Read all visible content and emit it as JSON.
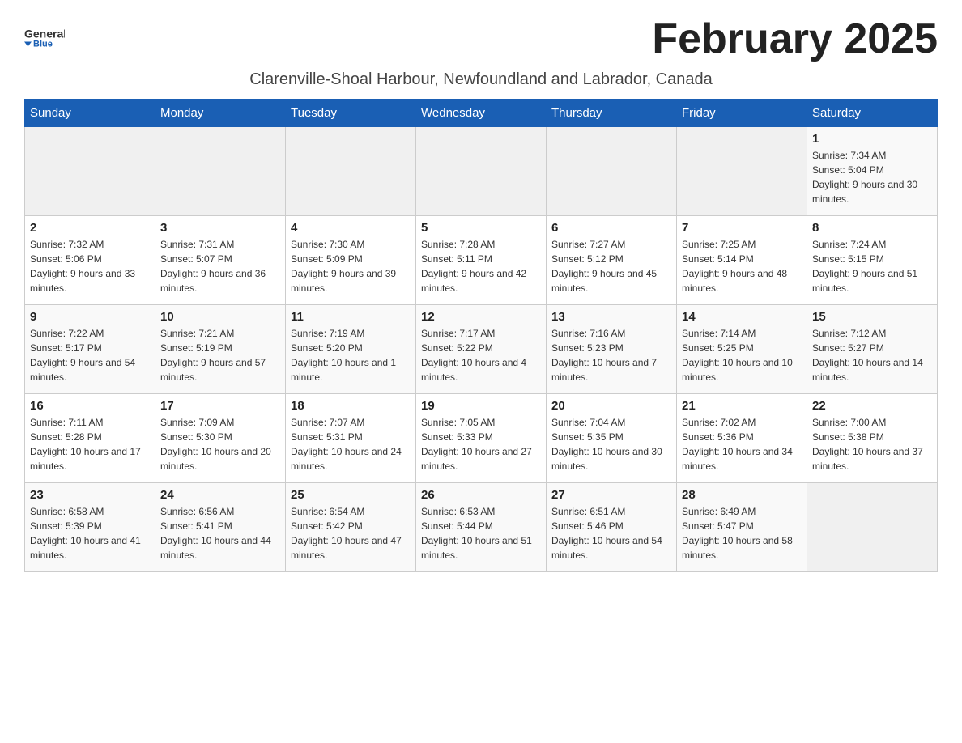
{
  "header": {
    "logo_general": "General",
    "logo_blue": "Blue",
    "month_title": "February 2025",
    "subtitle": "Clarenville-Shoal Harbour, Newfoundland and Labrador, Canada"
  },
  "days_of_week": [
    "Sunday",
    "Monday",
    "Tuesday",
    "Wednesday",
    "Thursday",
    "Friday",
    "Saturday"
  ],
  "weeks": [
    {
      "days": [
        {
          "num": "",
          "info": ""
        },
        {
          "num": "",
          "info": ""
        },
        {
          "num": "",
          "info": ""
        },
        {
          "num": "",
          "info": ""
        },
        {
          "num": "",
          "info": ""
        },
        {
          "num": "",
          "info": ""
        },
        {
          "num": "1",
          "info": "Sunrise: 7:34 AM\nSunset: 5:04 PM\nDaylight: 9 hours and 30 minutes."
        }
      ]
    },
    {
      "days": [
        {
          "num": "2",
          "info": "Sunrise: 7:32 AM\nSunset: 5:06 PM\nDaylight: 9 hours and 33 minutes."
        },
        {
          "num": "3",
          "info": "Sunrise: 7:31 AM\nSunset: 5:07 PM\nDaylight: 9 hours and 36 minutes."
        },
        {
          "num": "4",
          "info": "Sunrise: 7:30 AM\nSunset: 5:09 PM\nDaylight: 9 hours and 39 minutes."
        },
        {
          "num": "5",
          "info": "Sunrise: 7:28 AM\nSunset: 5:11 PM\nDaylight: 9 hours and 42 minutes."
        },
        {
          "num": "6",
          "info": "Sunrise: 7:27 AM\nSunset: 5:12 PM\nDaylight: 9 hours and 45 minutes."
        },
        {
          "num": "7",
          "info": "Sunrise: 7:25 AM\nSunset: 5:14 PM\nDaylight: 9 hours and 48 minutes."
        },
        {
          "num": "8",
          "info": "Sunrise: 7:24 AM\nSunset: 5:15 PM\nDaylight: 9 hours and 51 minutes."
        }
      ]
    },
    {
      "days": [
        {
          "num": "9",
          "info": "Sunrise: 7:22 AM\nSunset: 5:17 PM\nDaylight: 9 hours and 54 minutes."
        },
        {
          "num": "10",
          "info": "Sunrise: 7:21 AM\nSunset: 5:19 PM\nDaylight: 9 hours and 57 minutes."
        },
        {
          "num": "11",
          "info": "Sunrise: 7:19 AM\nSunset: 5:20 PM\nDaylight: 10 hours and 1 minute."
        },
        {
          "num": "12",
          "info": "Sunrise: 7:17 AM\nSunset: 5:22 PM\nDaylight: 10 hours and 4 minutes."
        },
        {
          "num": "13",
          "info": "Sunrise: 7:16 AM\nSunset: 5:23 PM\nDaylight: 10 hours and 7 minutes."
        },
        {
          "num": "14",
          "info": "Sunrise: 7:14 AM\nSunset: 5:25 PM\nDaylight: 10 hours and 10 minutes."
        },
        {
          "num": "15",
          "info": "Sunrise: 7:12 AM\nSunset: 5:27 PM\nDaylight: 10 hours and 14 minutes."
        }
      ]
    },
    {
      "days": [
        {
          "num": "16",
          "info": "Sunrise: 7:11 AM\nSunset: 5:28 PM\nDaylight: 10 hours and 17 minutes."
        },
        {
          "num": "17",
          "info": "Sunrise: 7:09 AM\nSunset: 5:30 PM\nDaylight: 10 hours and 20 minutes."
        },
        {
          "num": "18",
          "info": "Sunrise: 7:07 AM\nSunset: 5:31 PM\nDaylight: 10 hours and 24 minutes."
        },
        {
          "num": "19",
          "info": "Sunrise: 7:05 AM\nSunset: 5:33 PM\nDaylight: 10 hours and 27 minutes."
        },
        {
          "num": "20",
          "info": "Sunrise: 7:04 AM\nSunset: 5:35 PM\nDaylight: 10 hours and 30 minutes."
        },
        {
          "num": "21",
          "info": "Sunrise: 7:02 AM\nSunset: 5:36 PM\nDaylight: 10 hours and 34 minutes."
        },
        {
          "num": "22",
          "info": "Sunrise: 7:00 AM\nSunset: 5:38 PM\nDaylight: 10 hours and 37 minutes."
        }
      ]
    },
    {
      "days": [
        {
          "num": "23",
          "info": "Sunrise: 6:58 AM\nSunset: 5:39 PM\nDaylight: 10 hours and 41 minutes."
        },
        {
          "num": "24",
          "info": "Sunrise: 6:56 AM\nSunset: 5:41 PM\nDaylight: 10 hours and 44 minutes."
        },
        {
          "num": "25",
          "info": "Sunrise: 6:54 AM\nSunset: 5:42 PM\nDaylight: 10 hours and 47 minutes."
        },
        {
          "num": "26",
          "info": "Sunrise: 6:53 AM\nSunset: 5:44 PM\nDaylight: 10 hours and 51 minutes."
        },
        {
          "num": "27",
          "info": "Sunrise: 6:51 AM\nSunset: 5:46 PM\nDaylight: 10 hours and 54 minutes."
        },
        {
          "num": "28",
          "info": "Sunrise: 6:49 AM\nSunset: 5:47 PM\nDaylight: 10 hours and 58 minutes."
        },
        {
          "num": "",
          "info": ""
        }
      ]
    }
  ]
}
